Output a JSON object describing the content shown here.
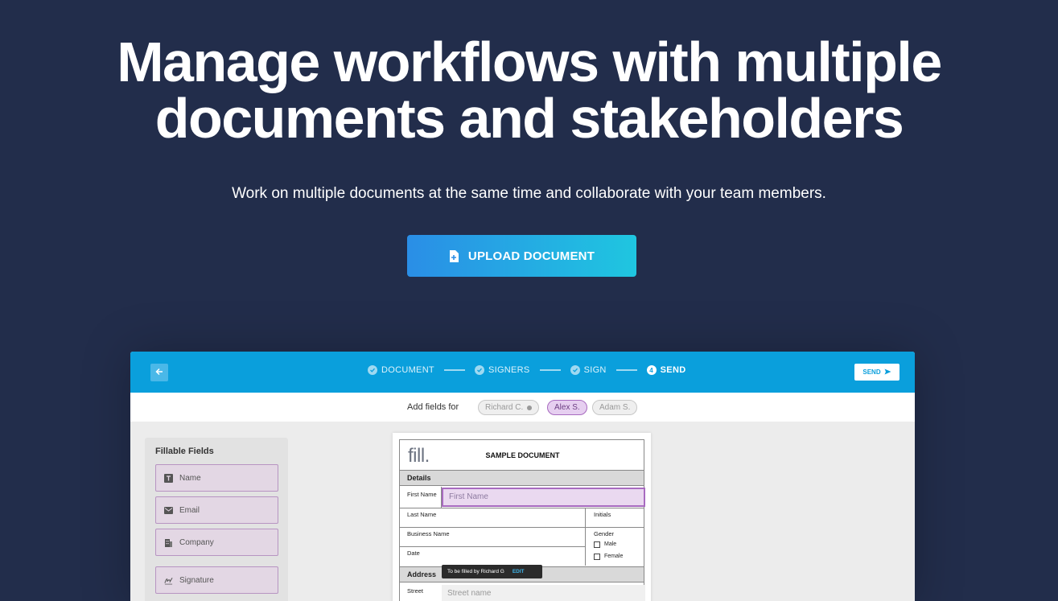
{
  "hero": {
    "title_line1": "Manage workflows with multiple",
    "title_line2": "documents and stakeholders",
    "subtitle": "Work on multiple documents at the same time and collaborate with your team members.",
    "upload_label": "UPLOAD DOCUMENT",
    "upload_icon": "file-plus-icon"
  },
  "app": {
    "steps": [
      {
        "label": "DOCUMENT",
        "state": "done"
      },
      {
        "label": "SIGNERS",
        "state": "done"
      },
      {
        "label": "SIGN",
        "state": "done"
      },
      {
        "label": "SEND",
        "state": "active",
        "number": "4"
      }
    ],
    "send_label": "SEND",
    "fields_for_label": "Add fields for",
    "signers": [
      "Richard C.",
      "Alex S.",
      "Adam S."
    ],
    "selected_signer": "Alex S.",
    "panel": {
      "title": "Fillable Fields",
      "fields": [
        {
          "label": "Name",
          "icon": "text-icon"
        },
        {
          "label": "Email",
          "icon": "envelope-icon"
        },
        {
          "label": "Company",
          "icon": "building-icon"
        },
        {
          "label": "Signature",
          "icon": "signature-icon"
        }
      ]
    },
    "document": {
      "logo": "fill.",
      "title": "SAMPLE DOCUMENT",
      "details_header": "Details",
      "first_name_label": "First Name",
      "first_name_placeholder": "First Name",
      "last_name_label": "Last Name",
      "initials_label": "Initials",
      "business_name_label": "Business Name",
      "gender_label": "Gender",
      "male_label": "Male",
      "female_label": "Female",
      "date_label": "Date",
      "address_header": "Address",
      "street_label": "Street",
      "street_placeholder": "Street name",
      "tooltip_text": "To be filled by Richard G",
      "tooltip_edit": "EDIT"
    }
  },
  "colors": {
    "background": "#222d4b",
    "app_bar": "#0a9fdc",
    "button_gradient_start": "#2a8ee6",
    "button_gradient_end": "#1fc6e0",
    "field_accent": "#a86bc0"
  }
}
